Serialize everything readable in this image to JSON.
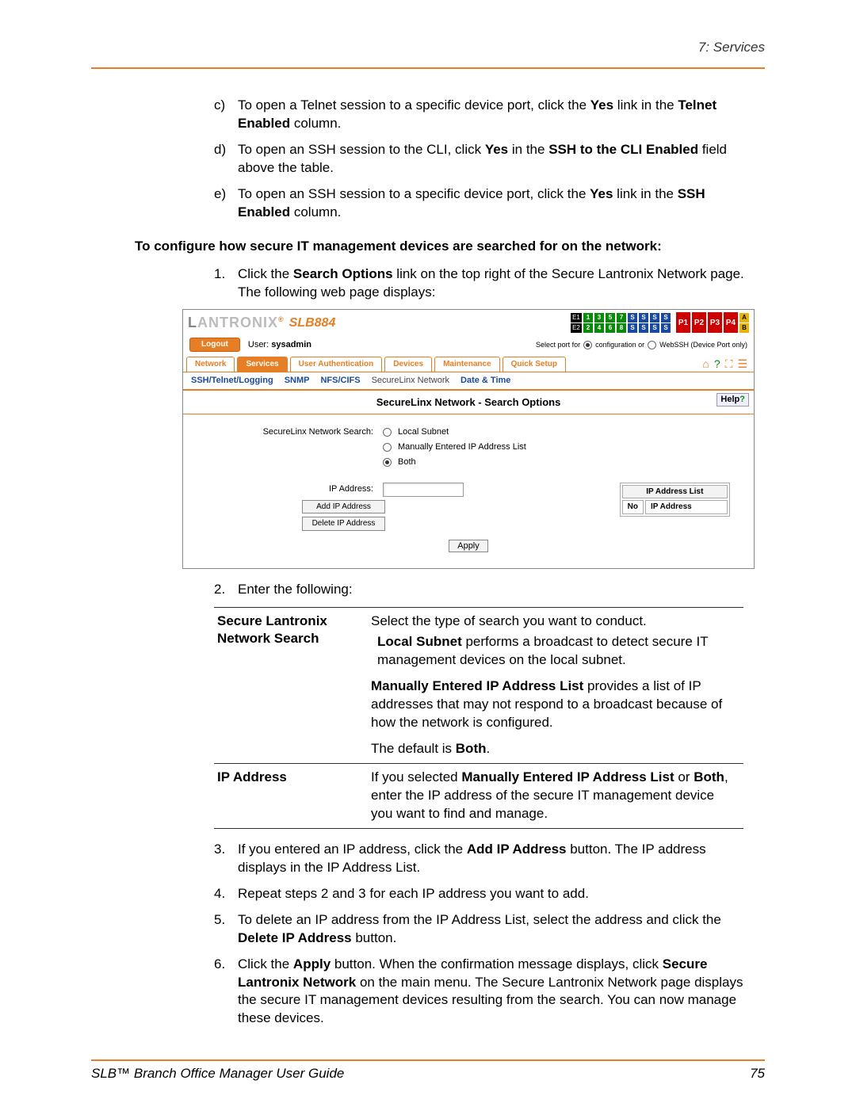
{
  "header": {
    "chapter": "7: Services"
  },
  "list_letters": {
    "c": {
      "marker": "c)",
      "t1": "To open a Telnet session to a specific device port, click the ",
      "yes": "Yes",
      "t2": " link in the ",
      "bold": "Telnet Enabled",
      "t3": " column."
    },
    "d": {
      "marker": "d)",
      "t1": "To open an SSH session to the CLI, click ",
      "yes": "Yes",
      "t2": " in the ",
      "bold": "SSH to the CLI Enabled",
      "t3": " field above the table."
    },
    "e": {
      "marker": "e)",
      "t1": "To open an SSH session to a specific device port, click the ",
      "yes": "Yes",
      "t2": " link in the ",
      "bold": "SSH Enabled",
      "t3": " column."
    }
  },
  "section_heading": "To configure how secure IT management devices are searched for on the network:",
  "steps": {
    "s1": {
      "marker": "1.",
      "t1": "Click the ",
      "b1": "Search Options",
      "t2": " link on the top right of the Secure Lantronix Network page. The following web page displays:"
    },
    "s2": {
      "marker": "2.",
      "t": "Enter the following:"
    },
    "s3": {
      "marker": "3.",
      "t1": "If you entered an IP address, click the ",
      "b1": "Add IP Address",
      "t2": " button. The IP address displays in the IP Address List."
    },
    "s4": {
      "marker": "4.",
      "t": "Repeat steps 2 and 3 for each IP address you want to add."
    },
    "s5": {
      "marker": "5.",
      "t1": "To delete an IP address from the IP Address List, select the address and click the ",
      "b1": "Delete IP Address",
      "t2": " button."
    },
    "s6": {
      "marker": "6.",
      "t1": "Click the ",
      "b1": "Apply",
      "t2": " button. When the confirmation message displays, click ",
      "b2": "Secure Lantronix Network",
      "t3": " on the main menu. The Secure Lantronix Network page displays the secure IT management devices resulting from the search. You can now manage these devices."
    }
  },
  "screenshot": {
    "logo1": "L",
    "logo2": "ANTRONIX",
    "logo3": "®",
    "product": "SLB884",
    "e1": "E1",
    "e2": "E2",
    "n1": "1",
    "n2": "2",
    "n3": "3",
    "n4": "4",
    "n5": "5",
    "n6": "6",
    "n7": "7",
    "n8": "8",
    "s": "S",
    "p1": "P1",
    "p2": "P2",
    "p3": "P3",
    "p4": "P4",
    "pA": "A",
    "pB": "B",
    "logout": "Logout",
    "user_label": "User: ",
    "user": "sysadmin",
    "select_port": "Select port for",
    "conf": "configuration or",
    "webssh": "WebSSH (Device Port only)",
    "tabs": {
      "network": "Network",
      "services": "Services",
      "userauth": "User Authentication",
      "devices": "Devices",
      "maintenance": "Maintenance",
      "quicksetup": "Quick Setup"
    },
    "subtabs": {
      "ssh": "SSH/Telnet/Logging",
      "snmp": "SNMP",
      "nfs": "NFS/CIFS",
      "sln": "SecureLinx Network",
      "dt": "Date & Time"
    },
    "panel_title": "SecureLinx Network - Search Options",
    "help": "Help",
    "form": {
      "search_label": "SecureLinx Network Search:",
      "opt1": "Local Subnet",
      "opt2": "Manually Entered IP Address List",
      "opt3": "Both",
      "ip_label": "IP Address:",
      "add_btn": "Add IP Address",
      "del_btn": "Delete IP Address",
      "list_header": "IP Address List",
      "col1": "No",
      "col2": "IP Address",
      "apply": "Apply"
    }
  },
  "options_table": {
    "row1": {
      "label": "Secure Lantronix Network Search",
      "p1": "Select the type of search you want to conduct.",
      "p2a": "Local Subnet",
      "p2b": " performs a broadcast to detect secure IT management devices on the local subnet.",
      "p3a": "Manually Entered IP Address List",
      "p3b": " provides a list of IP addresses that may not respond to a broadcast because of how the network is configured.",
      "p4a": "The default is ",
      "p4b": "Both",
      "p4c": "."
    },
    "row2": {
      "label": "IP Address",
      "t1": "If you selected ",
      "b1": "Manually Entered IP Address List",
      "t2": " or ",
      "b2": "Both",
      "t3": ", enter the IP address of the secure IT management device you want to find and manage."
    }
  },
  "footer": {
    "title": "SLB™ Branch Office Manager User Guide",
    "page": "75"
  }
}
